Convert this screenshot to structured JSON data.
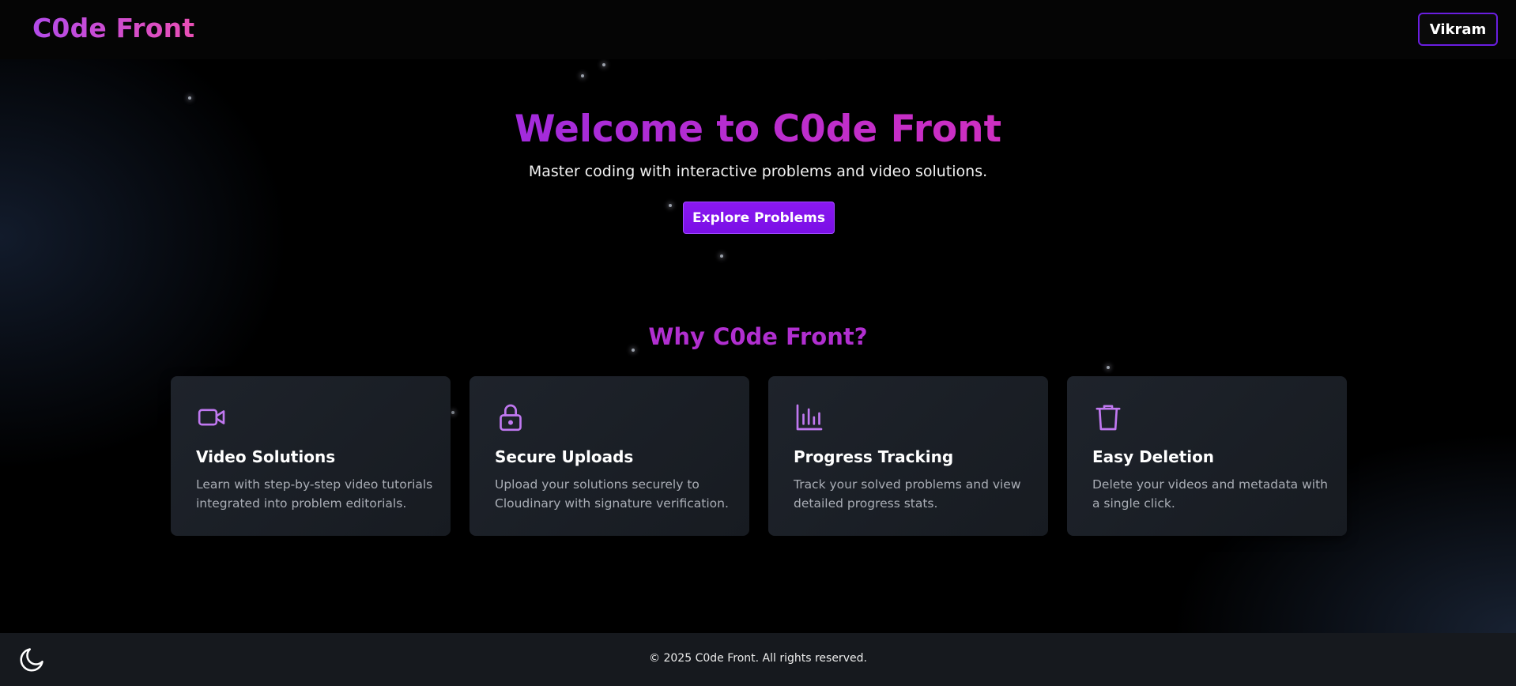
{
  "header": {
    "logo": "C0de Front",
    "user_button": "Vikram"
  },
  "hero": {
    "title": "Welcome to C0de Front",
    "subtitle": "Master coding with interactive problems and video solutions.",
    "cta": "Explore Problems"
  },
  "features": {
    "title": "Why C0de Front?",
    "cards": [
      {
        "icon": "video-camera-icon",
        "title": "Video Solutions",
        "text": "Learn with step-by-step video tutorials integrated into problem editorials."
      },
      {
        "icon": "lock-icon",
        "title": "Secure Uploads",
        "text": "Upload your solutions securely to Cloudinary with signature verification."
      },
      {
        "icon": "bar-chart-icon",
        "title": "Progress Tracking",
        "text": "Track your solved problems and view detailed progress stats."
      },
      {
        "icon": "trash-icon",
        "title": "Easy Deletion",
        "text": "Delete your videos and metadata with a single click."
      }
    ]
  },
  "footer": {
    "copyright": "© 2025 C0de Front. All rights reserved.",
    "theme_toggle_icon": "moon-icon"
  },
  "colors": {
    "accent": "#8a18f0",
    "icon": "#c078f0",
    "heading_gradient_start": "#a22bdc",
    "heading_gradient_end": "#cf2fc1"
  }
}
